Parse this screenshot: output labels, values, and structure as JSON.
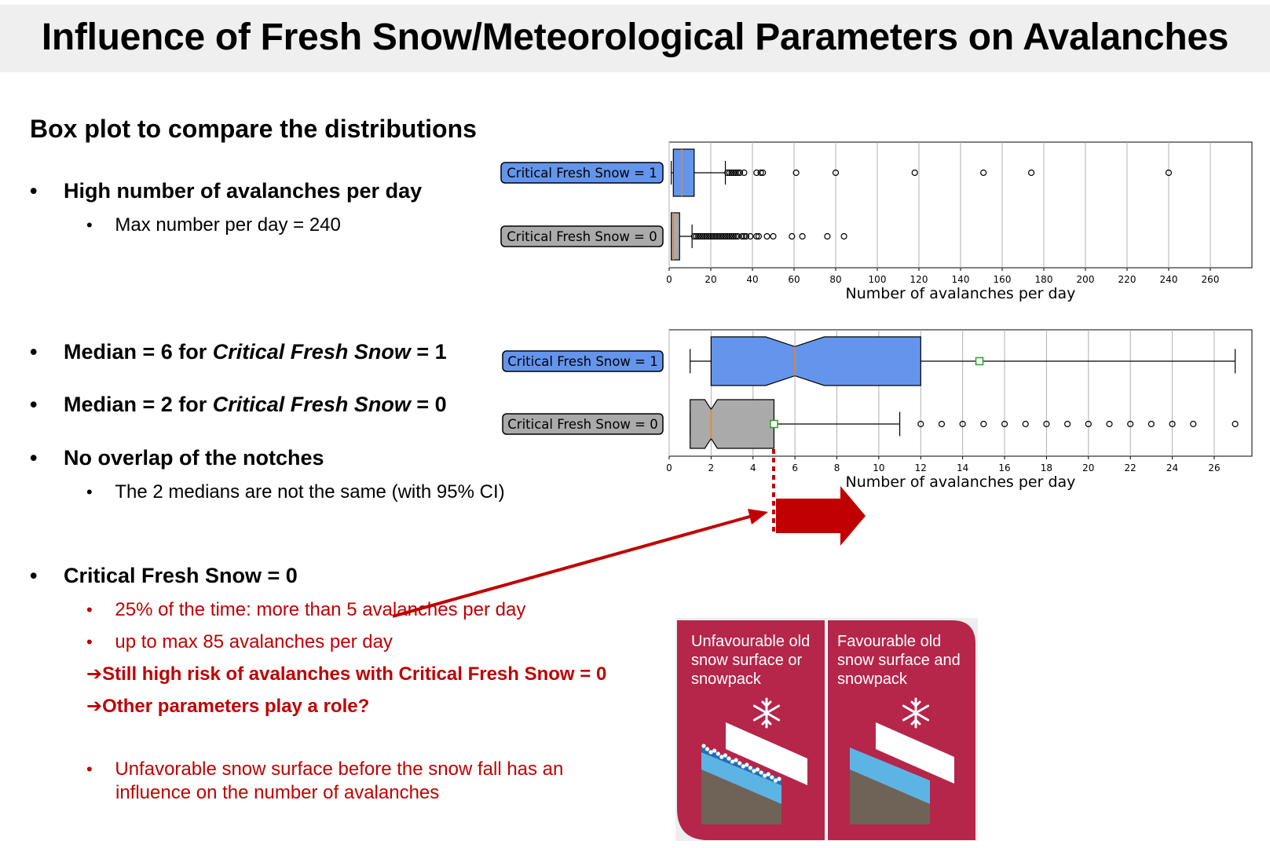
{
  "title": "Influence of Fresh Snow/Meteorological Parameters on Avalanches",
  "section_heading": "Box plot to compare the distributions",
  "bullets": {
    "high": "High number of avalanches per day",
    "max": "Max number per day = 240",
    "median1_pre": "Median = 6 for ",
    "median1_em": "Critical Fresh Snow",
    "median1_post": " = 1",
    "median0_pre": "Median = 2 for ",
    "median0_em": "Critical Fresh Snow",
    "median0_post": " = 0",
    "overlap": "No overlap of the notches",
    "medians_diff": "The 2 medians are not the same (with 95% CI)",
    "cfs0": "Critical Fresh Snow = 0",
    "pct25": "25% of the time: more than 5 avalanches per day",
    "max85": "up to max 85 avalanches per day",
    "still": "Still high risk of avalanches with Critical Fresh Snow = 0",
    "other": "Other parameters play a role?",
    "unfav_l1": "Unfavorable snow surface before the snow fall has an",
    "unfav_l2": "influence on the number of avalanches"
  },
  "bullet_symbol": "•",
  "arrow_symbol": "➔",
  "panels": {
    "left": [
      "Unfavourable old",
      "snow surface or",
      "snowpack"
    ],
    "right": [
      "Favourable old",
      "snow surface and",
      "snowpack"
    ],
    "icon": "snowflake-icon",
    "colors": {
      "panel": "#b5264a",
      "snow": "#ffffff",
      "layer": "#5cb4e4",
      "ground": "#6f6357"
    }
  },
  "colors": {
    "box1": "#6495ed",
    "box0": "#aaaaaa",
    "median": "#ff7f0e",
    "mean": "#2ca02c",
    "accent_red": "#c00000"
  },
  "chart_data": [
    {
      "type": "box",
      "orientation": "horizontal",
      "xlabel": "Number of avalanches per day",
      "xlim": [
        0,
        280
      ],
      "xticks": [
        0,
        20,
        40,
        60,
        80,
        100,
        120,
        140,
        160,
        180,
        200,
        220,
        240,
        260
      ],
      "grid": "vertical",
      "series": [
        {
          "name": "Critical Fresh Snow = 1",
          "whislo": 1,
          "q1": 2,
          "median": 6,
          "q3": 12,
          "whishi": 27,
          "fliers": [
            28,
            29,
            30,
            31,
            32,
            33,
            34,
            36,
            42,
            44,
            45,
            61,
            80,
            118,
            151,
            174,
            240
          ]
        },
        {
          "name": "Critical Fresh Snow = 0",
          "whislo": 1,
          "q1": 1,
          "median": 2,
          "q3": 5,
          "whishi": 11,
          "fliers": [
            12,
            13,
            14,
            15,
            16,
            17,
            18,
            19,
            20,
            21,
            22,
            23,
            24,
            25,
            26,
            27,
            28,
            29,
            30,
            31,
            32,
            33,
            35,
            36,
            37,
            39,
            42,
            43,
            47,
            50,
            59,
            64,
            76,
            84
          ]
        }
      ]
    },
    {
      "type": "box",
      "orientation": "horizontal",
      "notched": true,
      "showmeans": true,
      "showfliers": true,
      "xlabel": "Number of avalanches per day",
      "xlim": [
        0,
        27.8
      ],
      "xticks": [
        0,
        2,
        4,
        6,
        8,
        10,
        12,
        14,
        16,
        18,
        20,
        22,
        24,
        26
      ],
      "grid": "vertical",
      "series": [
        {
          "name": "Critical Fresh Snow = 1",
          "whislo": 1,
          "q1": 2,
          "median": 6,
          "q3": 12,
          "whishi": 27,
          "notch": [
            4.6,
            7.4
          ],
          "mean": 14.8,
          "fliers": []
        },
        {
          "name": "Critical Fresh Snow = 0",
          "whislo": 1,
          "q1": 1,
          "median": 2,
          "q3": 5,
          "whishi": 11,
          "notch": [
            1.7,
            2.3
          ],
          "mean": 5,
          "fliers": [
            12,
            13,
            14,
            15,
            16,
            17,
            18,
            19,
            20,
            21,
            22,
            23,
            24,
            25,
            27
          ]
        }
      ]
    }
  ]
}
